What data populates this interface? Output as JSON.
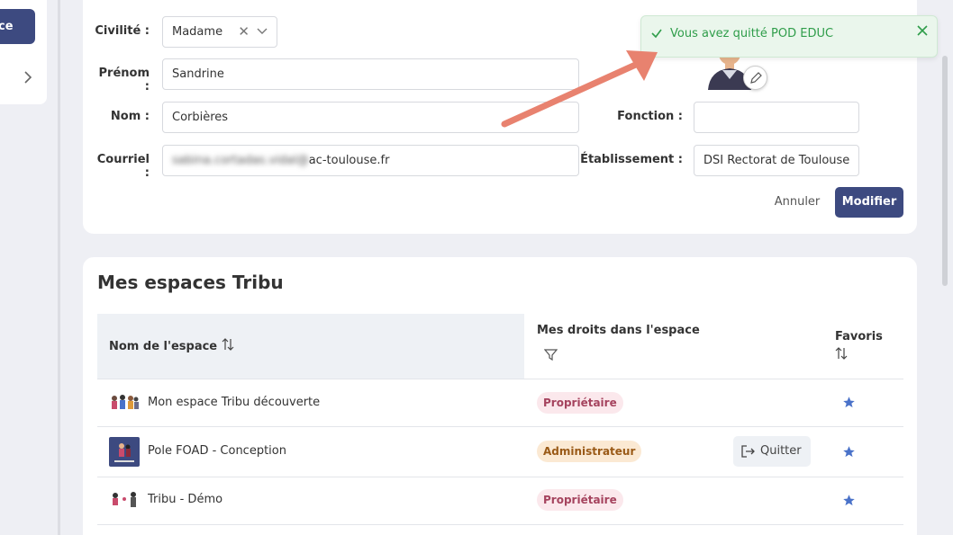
{
  "sidebar": {
    "button_label": "ce"
  },
  "toast": {
    "message": "Vous avez quitté POD EDUC"
  },
  "profile": {
    "civilite_label": "Civilité :",
    "civilite_value": "Madame",
    "prenom_label": "Prénom :",
    "prenom_value": "Sandrine",
    "nom_label": "Nom :",
    "nom_value": "Corbières",
    "courriel_label": "Courriel :",
    "courriel_blurred": "sabina.cortadas.vidal@",
    "courriel_value": "ac-toulouse.fr",
    "fonction_label": "Fonction :",
    "fonction_value": "",
    "etablissement_label": "Établissement :",
    "etablissement_value": "DSI Rectorat de Toulouse",
    "cancel_label": "Annuler",
    "submit_label": "Modifier"
  },
  "spaces": {
    "title": "Mes espaces Tribu",
    "columns": {
      "name": "Nom de l'espace",
      "rights": "Mes droits dans l'espace",
      "favorites": "Favoris"
    },
    "rows": [
      {
        "name": "Mon espace Tribu découverte",
        "role": "Propriétaire",
        "favorite": true
      },
      {
        "name": "Pole FOAD - Conception",
        "role": "Administrateur",
        "action": "Quitter",
        "favorite": true
      },
      {
        "name": "Tribu - Démo",
        "role": "Propriétaire",
        "favorite": true
      }
    ]
  },
  "colors": {
    "primary": "#3d4a80",
    "success": "#2f9d4a",
    "owner_badge": "#fbe8ec",
    "admin_badge": "#fbe9d3",
    "star": "#4a72c9",
    "annotation_arrow": "#e8826f"
  }
}
